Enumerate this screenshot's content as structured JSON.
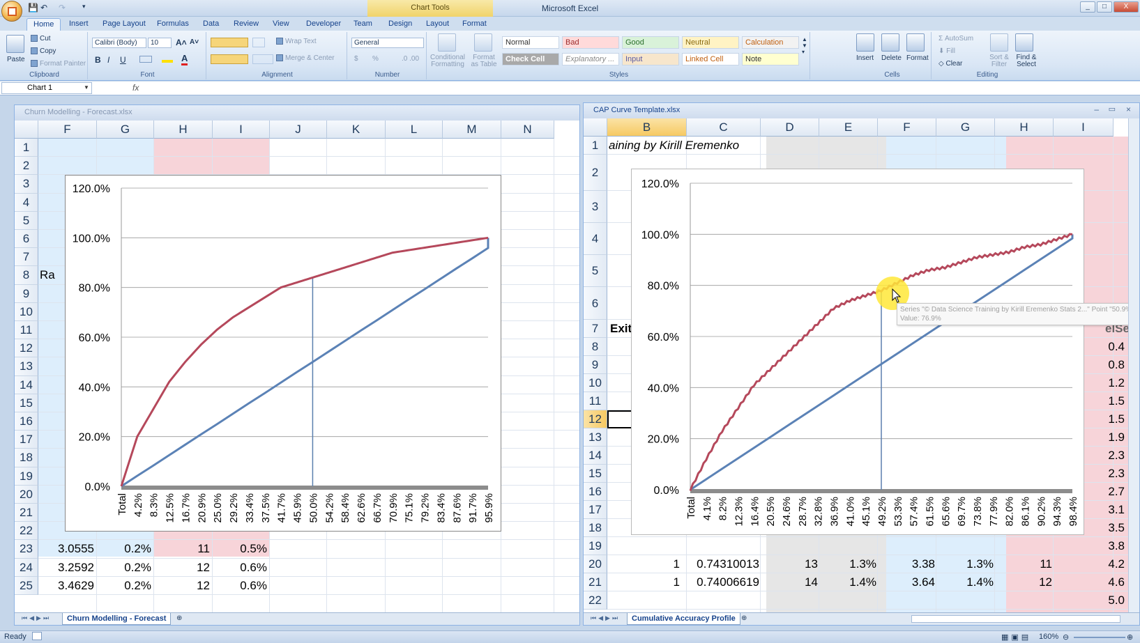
{
  "window": {
    "title": "Microsoft Excel",
    "context_tab": "Chart Tools",
    "controls": [
      "_",
      "□",
      "X"
    ]
  },
  "ribbon": {
    "tabs": [
      "Home",
      "Insert",
      "Page Layout",
      "Formulas",
      "Data",
      "Review",
      "View",
      "Developer",
      "Team",
      "Design",
      "Layout",
      "Format"
    ],
    "active_tab": "Home",
    "clipboard": {
      "label": "Clipboard",
      "paste": "Paste",
      "cut": "Cut",
      "copy": "Copy",
      "format_painter": "Format Painter"
    },
    "font": {
      "label": "Font",
      "name": "Calibri (Body)",
      "size": "10",
      "bold": "B",
      "italic": "I",
      "underline": "U"
    },
    "alignment": {
      "label": "Alignment",
      "wrap": "Wrap Text",
      "merge": "Merge & Center"
    },
    "number": {
      "label": "Number",
      "format": "General",
      "currency": "$",
      "percent": "%"
    },
    "styles": {
      "label": "Styles",
      "conditional": "Conditional Formatting",
      "format_table": "Format as Table",
      "cells": [
        "Normal",
        "Bad",
        "Good",
        "Neutral",
        "Calculation",
        "Check Cell",
        "Explanatory ...",
        "Input",
        "Linked Cell",
        "Note"
      ]
    },
    "cells": {
      "label": "Cells",
      "insert": "Insert",
      "delete": "Delete",
      "format": "Format"
    },
    "editing": {
      "label": "Editing",
      "autosum": "AutoSum",
      "fill": "Fill",
      "clear": "Clear",
      "sort": "Sort & Filter",
      "find": "Find & Select"
    }
  },
  "formula_bar": {
    "name_box": "Chart 1",
    "fx": "fx",
    "value": ""
  },
  "left_workbook": {
    "title": "Churn Modelling - Forecast.xlsx",
    "columns": [
      "F",
      "G",
      "H",
      "I",
      "J",
      "K",
      "L",
      "M",
      "N"
    ],
    "rows": [
      "1",
      "2",
      "3",
      "4",
      "5",
      "6",
      "7",
      "8",
      "9",
      "10",
      "11",
      "12",
      "13",
      "14",
      "15",
      "16",
      "17",
      "18",
      "19",
      "20",
      "21",
      "22",
      "23",
      "24",
      "25"
    ],
    "partial_label": "Ra",
    "data_rows": [
      {
        "row": "23",
        "f": "3.0555",
        "g": "0.2%",
        "h": "11",
        "i": "0.5%"
      },
      {
        "row": "24",
        "f": "3.2592",
        "g": "0.2%",
        "h": "12",
        "i": "0.6%"
      },
      {
        "row": "25",
        "f": "3.4629",
        "g": "0.2%",
        "h": "12",
        "i": "0.6%"
      }
    ],
    "sheet_tab": "Churn Modelling - Forecast"
  },
  "right_workbook": {
    "title": "CAP Curve Template.xlsx",
    "columns": [
      "B",
      "C",
      "D",
      "E",
      "F",
      "G",
      "H",
      "I"
    ],
    "rows": [
      "1",
      "2",
      "3",
      "4",
      "5",
      "6",
      "7",
      "8",
      "9",
      "10",
      "11",
      "12",
      "13",
      "14",
      "15",
      "16",
      "17",
      "18",
      "19",
      "20",
      "21",
      "22"
    ],
    "selected_row": "12",
    "header_text": "aining by Kirill Eremenko",
    "exit_label": "Exit",
    "partial_header": "elSe",
    "right_values": [
      "0.4",
      "0.8",
      "1.2",
      "1.5",
      "1.5",
      "1.9",
      "2.3",
      "2.3",
      "2.7",
      "3.1",
      "3.5",
      "3.8",
      "4.2",
      "4.6",
      "5.0"
    ],
    "data_rows": [
      {
        "row": "20",
        "b": "1",
        "c": "0.74310013",
        "d": "13",
        "e": "1.3%",
        "f": "3.38",
        "g": "1.3%",
        "h": "11",
        "i": "4.2"
      },
      {
        "row": "21",
        "b": "1",
        "c": "0.74006619",
        "d": "14",
        "e": "1.4%",
        "f": "3.64",
        "g": "1.4%",
        "h": "12",
        "i": "4.6"
      }
    ],
    "tooltip_line1": "Series \"© Data Science Training by Kirill Eremenko Stats 2...\" Point \"50.9%\"",
    "tooltip_line2": "Value: 76.9%",
    "sheet_tab": "Cumulative Accuracy Profile"
  },
  "status": {
    "ready": "Ready",
    "zoom": "160%"
  },
  "colors": {
    "model_line": "#b5485b",
    "random_line": "#5b82b6",
    "cursor_highlight": "#ffe838"
  },
  "chart_data": [
    {
      "type": "line",
      "title": "",
      "ylim": [
        0,
        1.2
      ],
      "yticks": [
        "0.0%",
        "20.0%",
        "40.0%",
        "60.0%",
        "80.0%",
        "100.0%",
        "120.0%"
      ],
      "categories": [
        "Total",
        "4.2%",
        "8.3%",
        "12.5%",
        "16.7%",
        "20.9%",
        "25.0%",
        "29.2%",
        "33.4%",
        "37.5%",
        "41.7%",
        "45.9%",
        "50.0%",
        "54.2%",
        "58.4%",
        "62.6%",
        "66.7%",
        "70.9%",
        "75.1%",
        "79.2%",
        "83.4%",
        "87.6%",
        "91.7%",
        "95.9%"
      ],
      "series": [
        {
          "values": [
            0,
            0.2,
            0.31,
            0.42,
            0.5,
            0.57,
            0.63,
            0.68,
            0.72,
            0.76,
            0.8,
            0.82,
            0.84,
            0.86,
            0.88,
            0.9,
            0.92,
            0.94,
            0.95,
            0.96,
            0.97,
            0.98,
            0.99,
            1.0
          ]
        },
        {
          "values": [
            0,
            0.042,
            0.083,
            0.125,
            0.167,
            0.209,
            0.25,
            0.292,
            0.334,
            0.375,
            0.417,
            0.459,
            0.5,
            0.542,
            0.584,
            0.626,
            0.667,
            0.709,
            0.751,
            0.792,
            0.834,
            0.876,
            0.917,
            0.959
          ]
        }
      ],
      "reference_line_x": "50.0%"
    },
    {
      "type": "line",
      "title": "",
      "ylim": [
        0,
        1.2
      ],
      "yticks": [
        "0.0%",
        "20.0%",
        "40.0%",
        "60.0%",
        "80.0%",
        "100.0%",
        "120.0%"
      ],
      "categories": [
        "Total",
        "4.1%",
        "8.2%",
        "12.3%",
        "16.4%",
        "20.5%",
        "24.6%",
        "28.7%",
        "32.8%",
        "36.9%",
        "41.0%",
        "45.1%",
        "49.2%",
        "53.3%",
        "57.4%",
        "61.5%",
        "65.6%",
        "69.7%",
        "73.8%",
        "77.9%",
        "82.0%",
        "86.1%",
        "90.2%",
        "94.3%",
        "98.4%"
      ],
      "series": [
        {
          "values": [
            0,
            0.12,
            0.23,
            0.32,
            0.41,
            0.47,
            0.53,
            0.59,
            0.65,
            0.71,
            0.74,
            0.76,
            0.78,
            0.81,
            0.84,
            0.86,
            0.87,
            0.89,
            0.91,
            0.92,
            0.93,
            0.95,
            0.96,
            0.98,
            1.0
          ]
        },
        {
          "values": [
            0,
            0.041,
            0.082,
            0.123,
            0.164,
            0.205,
            0.246,
            0.287,
            0.328,
            0.369,
            0.41,
            0.451,
            0.492,
            0.533,
            0.574,
            0.615,
            0.656,
            0.697,
            0.738,
            0.779,
            0.82,
            0.861,
            0.902,
            0.943,
            0.984
          ]
        }
      ],
      "reference_line_x": "49.2%",
      "hover_point": {
        "x": "50.9%",
        "y": 0.769
      }
    }
  ]
}
